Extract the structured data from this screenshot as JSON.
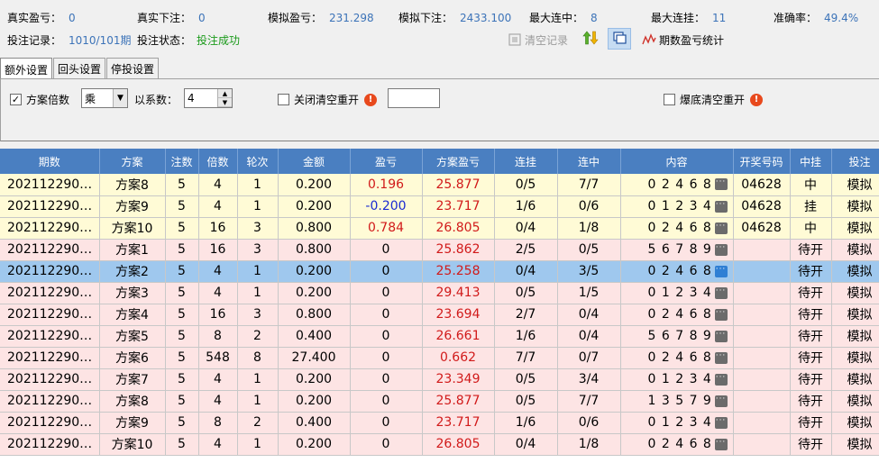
{
  "stats_row1": [
    {
      "label": "真实盈亏：",
      "value": "0"
    },
    {
      "label": "真实下注：",
      "value": "0"
    },
    {
      "label": "模拟盈亏：",
      "value": "231.298"
    },
    {
      "label": "模拟下注：",
      "value": "2433.100"
    },
    {
      "label": "最大连中：",
      "value": "8"
    },
    {
      "label": "最大连挂：",
      "value": "11"
    },
    {
      "label": "准确率：",
      "value": "49.4%"
    }
  ],
  "stats_row2": {
    "record_label": "投注记录：",
    "record_value": "1010/101期",
    "status_label": "投注状态：",
    "status_value": "投注成功"
  },
  "toolbar": {
    "clear_label": "清空记录",
    "stats_label": "期数盈亏统计"
  },
  "tabs": [
    "额外设置",
    "回头设置",
    "停投设置"
  ],
  "settings": {
    "multiplier_label": "方案倍数",
    "multiplier_checked": true,
    "operator_value": "乘",
    "coef_label": "以系数：",
    "coef_value": "4",
    "close_reset_label": "关闭清空重开",
    "close_reset_checked": false,
    "close_reset_value": "",
    "bottom_reset_label": "爆底清空重开",
    "bottom_reset_checked": false,
    "warn_icon": "!"
  },
  "table": {
    "headers": [
      "期数",
      "方案",
      "注数",
      "倍数",
      "轮次",
      "金额",
      "盈亏",
      "方案盈亏",
      "连挂",
      "连中",
      "内容",
      "开奖号码",
      "中挂",
      "投注"
    ],
    "rows": [
      {
        "cells": [
          "202112290…",
          "方案8",
          "5",
          "4",
          "1",
          "0.200",
          "0.196",
          "25.877",
          "0/5",
          "7/7",
          "0 2 4 6 8",
          "04628",
          "中",
          "模拟"
        ],
        "style": "yellow",
        "pl_color": "red"
      },
      {
        "cells": [
          "202112290…",
          "方案9",
          "5",
          "4",
          "1",
          "0.200",
          "-0.200",
          "23.717",
          "1/6",
          "0/6",
          "0 1 2 3 4",
          "04628",
          "挂",
          "模拟"
        ],
        "style": "yellow",
        "pl_color": "blue"
      },
      {
        "cells": [
          "202112290…",
          "方案10",
          "5",
          "16",
          "3",
          "0.800",
          "0.784",
          "26.805",
          "0/4",
          "1/8",
          "0 2 4 6 8",
          "04628",
          "中",
          "模拟"
        ],
        "style": "yellow",
        "pl_color": "red"
      },
      {
        "cells": [
          "202112290…",
          "方案1",
          "5",
          "16",
          "3",
          "0.800",
          "0",
          "25.862",
          "2/5",
          "0/5",
          "5 6 7 8 9",
          "",
          "待开",
          "模拟"
        ],
        "style": "pink",
        "pl_color": ""
      },
      {
        "cells": [
          "202112290…",
          "方案2",
          "5",
          "4",
          "1",
          "0.200",
          "0",
          "25.258",
          "0/4",
          "3/5",
          "0 2 4 6 8",
          "",
          "待开",
          "模拟"
        ],
        "style": "sel",
        "pl_color": ""
      },
      {
        "cells": [
          "202112290…",
          "方案3",
          "5",
          "4",
          "1",
          "0.200",
          "0",
          "29.413",
          "0/5",
          "1/5",
          "0 1 2 3 4",
          "",
          "待开",
          "模拟"
        ],
        "style": "pink",
        "pl_color": ""
      },
      {
        "cells": [
          "202112290…",
          "方案4",
          "5",
          "16",
          "3",
          "0.800",
          "0",
          "23.694",
          "2/7",
          "0/4",
          "0 2 4 6 8",
          "",
          "待开",
          "模拟"
        ],
        "style": "pink",
        "pl_color": ""
      },
      {
        "cells": [
          "202112290…",
          "方案5",
          "5",
          "8",
          "2",
          "0.400",
          "0",
          "26.661",
          "1/6",
          "0/4",
          "5 6 7 8 9",
          "",
          "待开",
          "模拟"
        ],
        "style": "pink",
        "pl_color": ""
      },
      {
        "cells": [
          "202112290…",
          "方案6",
          "5",
          "548",
          "8",
          "27.400",
          "0",
          "0.662",
          "7/7",
          "0/7",
          "0 2 4 6 8",
          "",
          "待开",
          "模拟"
        ],
        "style": "pink",
        "pl_color": ""
      },
      {
        "cells": [
          "202112290…",
          "方案7",
          "5",
          "4",
          "1",
          "0.200",
          "0",
          "23.349",
          "0/5",
          "3/4",
          "0 1 2 3 4",
          "",
          "待开",
          "模拟"
        ],
        "style": "pink",
        "pl_color": ""
      },
      {
        "cells": [
          "202112290…",
          "方案8",
          "5",
          "4",
          "1",
          "0.200",
          "0",
          "25.877",
          "0/5",
          "7/7",
          "1 3 5 7 9",
          "",
          "待开",
          "模拟"
        ],
        "style": "pink",
        "pl_color": ""
      },
      {
        "cells": [
          "202112290…",
          "方案9",
          "5",
          "8",
          "2",
          "0.400",
          "0",
          "23.717",
          "1/6",
          "0/6",
          "0 1 2 3 4",
          "",
          "待开",
          "模拟"
        ],
        "style": "pink",
        "pl_color": ""
      },
      {
        "cells": [
          "202112290…",
          "方案10",
          "5",
          "4",
          "1",
          "0.200",
          "0",
          "26.805",
          "0/4",
          "1/8",
          "0 2 4 6 8",
          "",
          "待开",
          "模拟"
        ],
        "style": "pink",
        "pl_color": ""
      }
    ]
  }
}
